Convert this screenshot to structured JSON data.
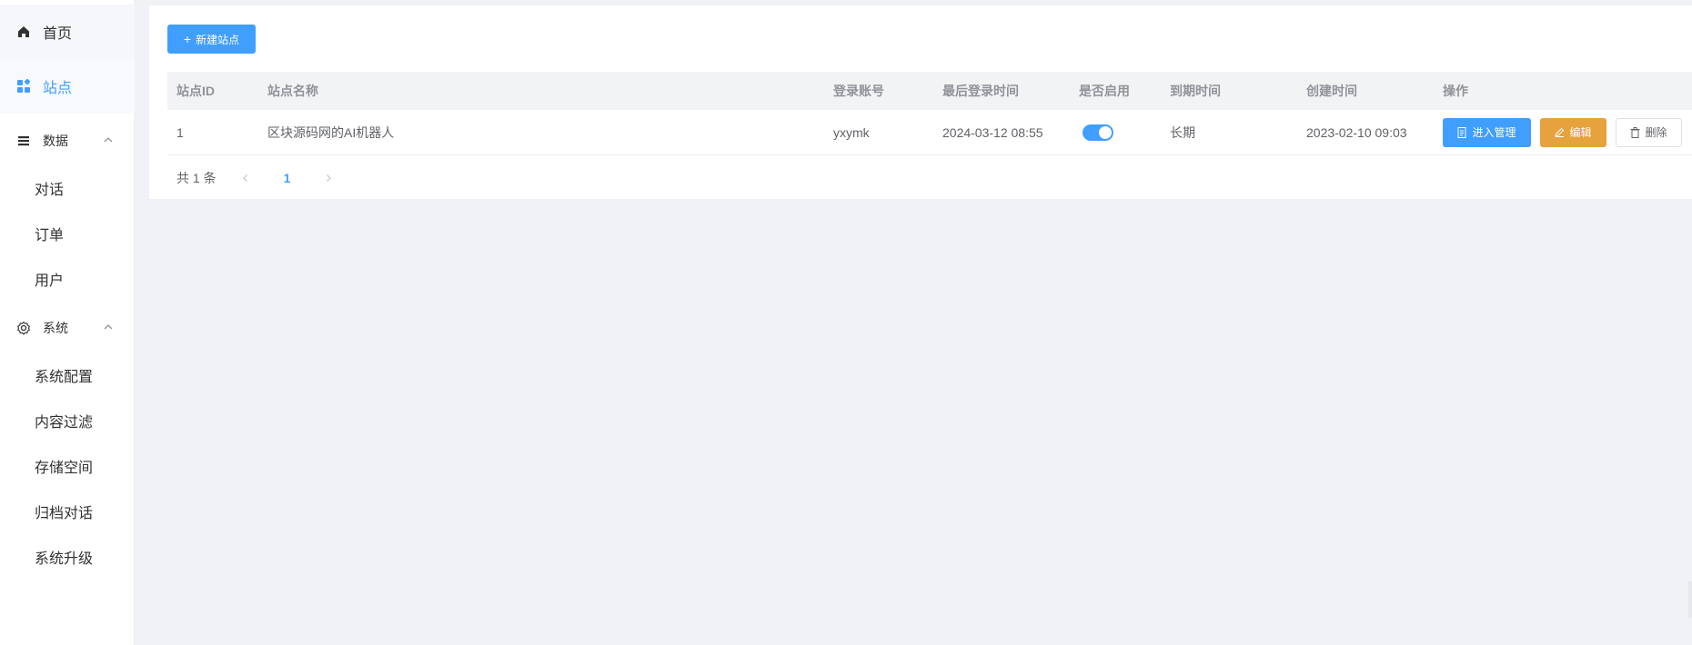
{
  "sidebar": {
    "home": "首页",
    "site": "站点",
    "data_group": "数据",
    "data_items": [
      "对话",
      "订单",
      "用户"
    ],
    "system_group": "系统",
    "system_items": [
      "系统配置",
      "内容过滤",
      "存储空间",
      "归档对话",
      "系统升级"
    ]
  },
  "toolbar": {
    "new_site": "新建站点"
  },
  "table": {
    "headers": [
      "站点ID",
      "站点名称",
      "登录账号",
      "最后登录时间",
      "是否启用",
      "到期时间",
      "创建时间",
      "操作"
    ],
    "rows": [
      {
        "id": "1",
        "name": "区块源码网的AI机器人",
        "account": "yxymk",
        "last_login": "2024-03-12 08:55",
        "enabled": true,
        "expire": "长期",
        "created": "2023-02-10 09:03"
      }
    ],
    "actions": {
      "enter": "进入管理",
      "edit": "编辑",
      "delete": "删除"
    }
  },
  "pagination": {
    "total": "共 1 条",
    "current_page": "1"
  },
  "colors": {
    "primary": "#409eff",
    "warning": "#e6a23c"
  }
}
